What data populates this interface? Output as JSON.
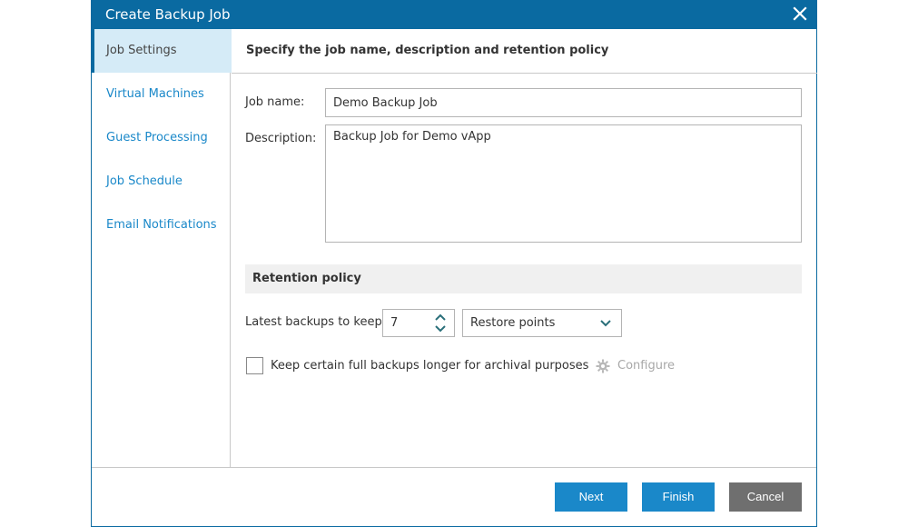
{
  "dialog": {
    "title": "Create Backup Job",
    "close_icon": "close-icon"
  },
  "sidebar": {
    "items": [
      {
        "label": "Job Settings",
        "active": true
      },
      {
        "label": "Virtual Machines",
        "active": false
      },
      {
        "label": "Guest Processing",
        "active": false
      },
      {
        "label": "Job Schedule",
        "active": false
      },
      {
        "label": "Email Notifications",
        "active": false
      }
    ]
  },
  "content": {
    "header": "Specify the job name, description and retention policy",
    "job_name": {
      "label": "Job name:",
      "value": "Demo Backup Job"
    },
    "description": {
      "label": "Description:",
      "value": "Backup Job for Demo vApp"
    },
    "retention": {
      "section_title": "Retention policy",
      "latest_label": "Latest backups to keep:",
      "latest_value": "7",
      "unit_selected": "Restore points",
      "archival_checkbox_label": "Keep certain full backups longer for archival purposes",
      "archival_checked": false,
      "configure_label": "Configure",
      "configure_icon": "gear-icon"
    }
  },
  "footer": {
    "next_label": "Next",
    "finish_label": "Finish",
    "cancel_label": "Cancel"
  },
  "colors": {
    "titlebar": "#0a6aa1",
    "primary_button": "#1a88c9",
    "cancel_button": "#6f6f6f",
    "nav_link": "#1a88c9",
    "nav_active_bg": "#d5ebf7"
  }
}
